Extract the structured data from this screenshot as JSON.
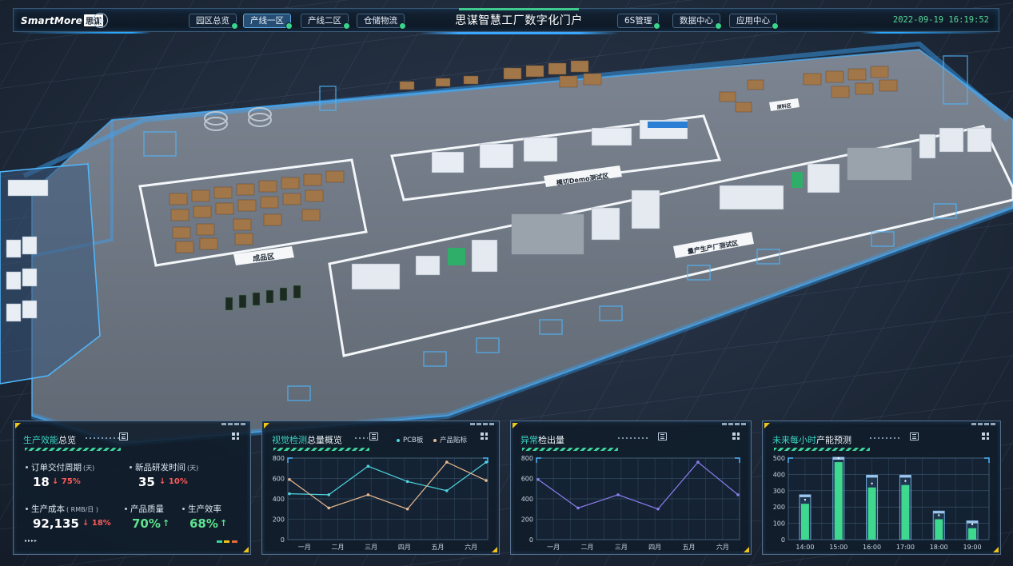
{
  "header": {
    "logo_text": "SmartMore",
    "logo_badge": "思谋",
    "title": "思谋智慧工厂数字化门户",
    "datetime": "2022-09-19 16:19:52",
    "tabs_left": [
      {
        "label": "园区总览",
        "active": false
      },
      {
        "label": "产线一区",
        "active": true
      },
      {
        "label": "产线二区",
        "active": false
      },
      {
        "label": "仓储物流",
        "active": false
      }
    ],
    "tabs_right": [
      {
        "label": "6S管理",
        "active": false
      },
      {
        "label": "数据中心",
        "active": false
      },
      {
        "label": "应用中心",
        "active": false
      }
    ]
  },
  "scene": {
    "zone_labels": [
      "成品区",
      "模切Demo测试区",
      "量产生产厂测试区",
      "原料区"
    ]
  },
  "kpi_panel": {
    "title_highlight": "生产效能",
    "title_rest": "总览",
    "items": {
      "order_cycle": {
        "label": "订单交付周期",
        "unit": "(天)",
        "value": "18",
        "delta": "↓ 75%"
      },
      "rd_time": {
        "label": "新品研发时间",
        "unit": "(天)",
        "value": "35",
        "delta": "↓ 10%"
      },
      "cost": {
        "label": "生产成本",
        "unit": "( RMB/日 )",
        "value": "92,135",
        "delta": "↓ 18%"
      },
      "quality": {
        "label": "产品质量",
        "value": "70%",
        "arrow": "↑"
      },
      "efficiency": {
        "label": "生产效率",
        "value": "68%",
        "arrow": "↑"
      }
    },
    "footer_arrows": "▸▸▸▸"
  },
  "chart_data": [
    {
      "type": "line",
      "title_highlight": "视觉检测",
      "title_rest": "总量概览",
      "categories": [
        "一月",
        "二月",
        "三月",
        "四月",
        "五月",
        "六月"
      ],
      "ylim": [
        0,
        800
      ],
      "yticks": [
        0,
        200,
        400,
        600,
        800
      ],
      "grid": true,
      "legend": "top-right",
      "series": [
        {
          "name": "PCB板",
          "color": "#4fd6e0",
          "values": [
            450,
            440,
            720,
            570,
            480,
            760
          ]
        },
        {
          "name": "产品贴标",
          "color": "#e9b98f",
          "values": [
            590,
            310,
            440,
            300,
            760,
            580
          ]
        }
      ]
    },
    {
      "type": "line",
      "title_highlight": "异常",
      "title_rest": "检出量",
      "categories": [
        "一月",
        "二月",
        "三月",
        "四月",
        "五月",
        "六月"
      ],
      "ylim": [
        0,
        800
      ],
      "yticks": [
        0,
        200,
        400,
        600,
        800
      ],
      "grid": true,
      "series": [
        {
          "color": "#8a7ef0",
          "values": [
            590,
            310,
            440,
            300,
            760,
            440
          ]
        }
      ]
    },
    {
      "type": "bar",
      "title_highlight": "未来每小时",
      "title_rest": "产能预测",
      "categories": [
        "14:00",
        "15:00",
        "16:00",
        "17:00",
        "18:00",
        "19:00"
      ],
      "ylim": [
        0,
        500
      ],
      "yticks": [
        0,
        100,
        200,
        300,
        400,
        500
      ],
      "grid": true,
      "series": [
        {
          "color": "#3ed88e",
          "values": [
            220,
            475,
            320,
            335,
            125,
            70
          ],
          "capacity": [
            275,
            505,
            395,
            395,
            175,
            115
          ]
        }
      ]
    }
  ]
}
